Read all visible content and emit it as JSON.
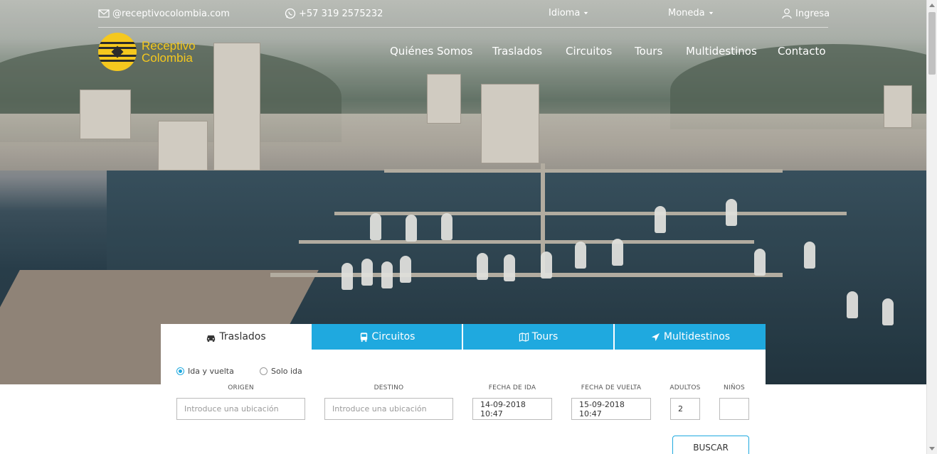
{
  "topbar": {
    "email": "@receptivocolombia.com",
    "phone": "+57 319 2575232",
    "language": "Idioma",
    "currency": "Moneda",
    "login": "Ingresa"
  },
  "logo": {
    "line1": "Receptivo",
    "line2": "Colombia"
  },
  "nav": {
    "items": [
      "Quiénes Somos",
      "Traslados",
      "Circuitos",
      "Tours",
      "Multidestinos",
      "Contacto"
    ]
  },
  "booking": {
    "tabs": [
      "Traslados",
      "Circuitos",
      "Tours",
      "Multidestinos"
    ],
    "active_tab": "Traslados",
    "trip_options": [
      "Ida y vuelta",
      "Solo ida"
    ],
    "selected_trip": "Ida y vuelta",
    "labels": {
      "origin": "ORIGEN",
      "destination": "DESTINO",
      "departure": "FECHA DE IDA",
      "return": "FECHA DE VUELTA",
      "adults": "ADULTOS",
      "children": "NIÑOS"
    },
    "placeholders": {
      "origin": "Introduce una ubicación",
      "destination": "Introduce una ubicación"
    },
    "values": {
      "departure": "14-09-2018 10:47",
      "return": "15-09-2018 10:47",
      "adults": "2",
      "children": ""
    },
    "search_button": "BUSCAR"
  },
  "colors": {
    "brand_yellow": "#f5c81e",
    "accent_blue": "#1fa9df"
  }
}
